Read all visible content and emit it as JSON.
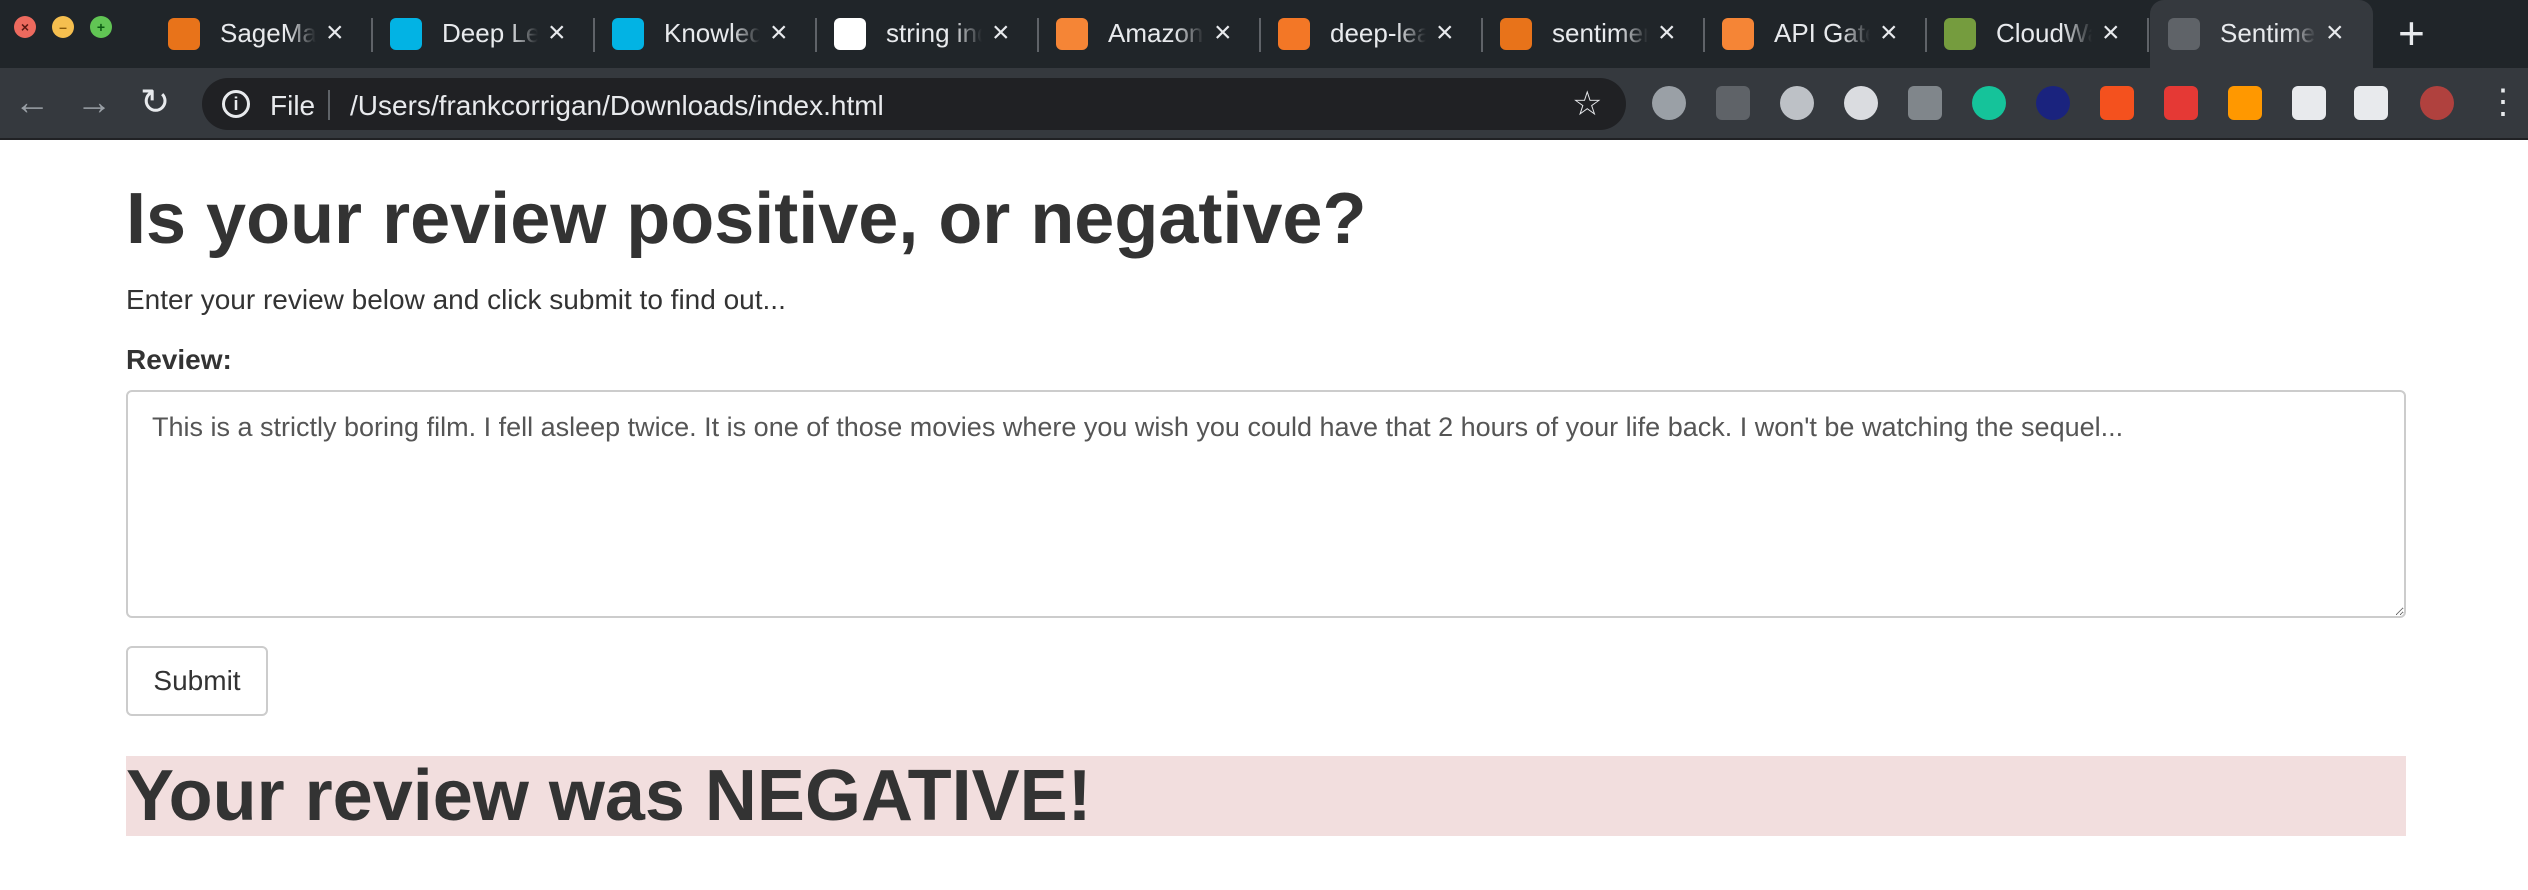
{
  "window_controls": {
    "close": "×",
    "minimize": "–",
    "maximize": "+"
  },
  "tabs": [
    {
      "title": "SageMaker",
      "favicon": "sagemaker-notebook-icon",
      "color": "#e8731a"
    },
    {
      "title": "Deep Learning",
      "favicon": "udacity-icon",
      "color": "#02b3e4"
    },
    {
      "title": "Knowledge",
      "favicon": "udacity-icon",
      "color": "#02b3e4"
    },
    {
      "title": "string index",
      "favicon": "github-icon",
      "color": "#ffffff"
    },
    {
      "title": "Amazon",
      "favicon": "aws-box-icon",
      "color": "#f58536"
    },
    {
      "title": "deep-learning",
      "favicon": "jupyter-icon",
      "color": "#f37726"
    },
    {
      "title": "sentiment",
      "favicon": "lambda-icon",
      "color": "#e8731a"
    },
    {
      "title": "API Gateway",
      "favicon": "aws-box-icon",
      "color": "#f58536"
    },
    {
      "title": "CloudWatch",
      "favicon": "cloudwatch-icon",
      "color": "#759c3e"
    },
    {
      "title": "Sentiment",
      "favicon": "globe-icon",
      "color": "#5f6368",
      "active": true
    }
  ],
  "tab_close_glyph": "×",
  "new_tab_glyph": "+",
  "toolbar": {
    "back_glyph": "←",
    "forward_glyph": "→",
    "reload_glyph": "↻",
    "info_glyph": "i",
    "scheme": "File",
    "url": "/Users/frankcorrigan/Downloads/index.html",
    "star_glyph": "☆",
    "menu_glyph": "⋮"
  },
  "extensions": [
    {
      "name": "extension-1-icon",
      "color": "#9aa0a6"
    },
    {
      "name": "extension-2-icon",
      "color": "#5f6368"
    },
    {
      "name": "dark-reader-icon",
      "color": "#bdc1c6"
    },
    {
      "name": "extension-4-icon",
      "color": "#dadce0"
    },
    {
      "name": "extension-5-icon",
      "color": "#80868b"
    },
    {
      "name": "grammarly-icon",
      "color": "#15c39a"
    },
    {
      "name": "extension-7-icon",
      "color": "#1a237e"
    },
    {
      "name": "extension-8-icon",
      "color": "#f4511e"
    },
    {
      "name": "extension-9-icon",
      "color": "#e53935"
    },
    {
      "name": "extension-10-icon",
      "color": "#ff9800"
    },
    {
      "name": "puzzle-icon",
      "color": "#e8eaed"
    },
    {
      "name": "media-queue-icon",
      "color": "#e8eaed"
    },
    {
      "name": "profile-avatar",
      "color": "#b0413e"
    }
  ],
  "page": {
    "heading": "Is your review positive, or negative?",
    "lead": "Enter your review below and click submit to find out...",
    "review_label": "Review:",
    "review_text": "This is a strictly boring film. I fell asleep twice. It is one of those movies where you wish you could have that 2 hours of your life back. I won't be watching the sequel...",
    "submit_label": "Submit",
    "result": "Your review was NEGATIVE!"
  },
  "colors": {
    "result_background": "#f2dede",
    "tabstrip": "#202529",
    "toolbar": "#35393e"
  }
}
